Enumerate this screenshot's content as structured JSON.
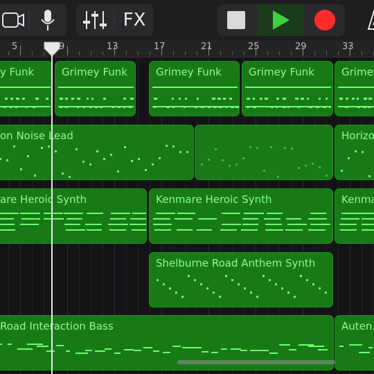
{
  "toolbar": {
    "fx_label": "FX",
    "icons": [
      "browser-icon",
      "microphone-icon",
      "mixer-sliders-icon",
      "stop-icon",
      "play-icon",
      "record-icon",
      "metronome-icon"
    ],
    "colors": {
      "play": "#3ed13e",
      "record": "#ff2b2b",
      "stop": "#d9d9d9"
    }
  },
  "ruler": {
    "bars": [
      "5",
      "9",
      "13",
      "17",
      "21",
      "25",
      "29",
      "33"
    ]
  },
  "tracks": [
    {
      "regions": [
        {
          "label": "y Funk"
        },
        {
          "label": "Grimey Funk"
        },
        {
          "label": "Grimey Funk"
        },
        {
          "label": "Grimey Funk"
        },
        {
          "label": "Grimey"
        }
      ]
    },
    {
      "regions": [
        {
          "label": "on Noise Lead"
        },
        {
          "label": ""
        },
        {
          "label": "Horizo"
        }
      ]
    },
    {
      "regions": [
        {
          "label": "are Heroic Synth"
        },
        {
          "label": "Kenmare Heroic Synth"
        },
        {
          "label": "Kenma"
        }
      ]
    },
    {
      "regions": [
        {
          "label": "Shelburne Road Anthem Synth"
        }
      ]
    },
    {
      "regions": [
        {
          "label": "Road Interaction Bass"
        },
        {
          "label": "Auten."
        }
      ]
    }
  ],
  "colors": {
    "region_fill": "#177a17",
    "region_text": "#8dff8d",
    "note": "#6dff6d"
  }
}
